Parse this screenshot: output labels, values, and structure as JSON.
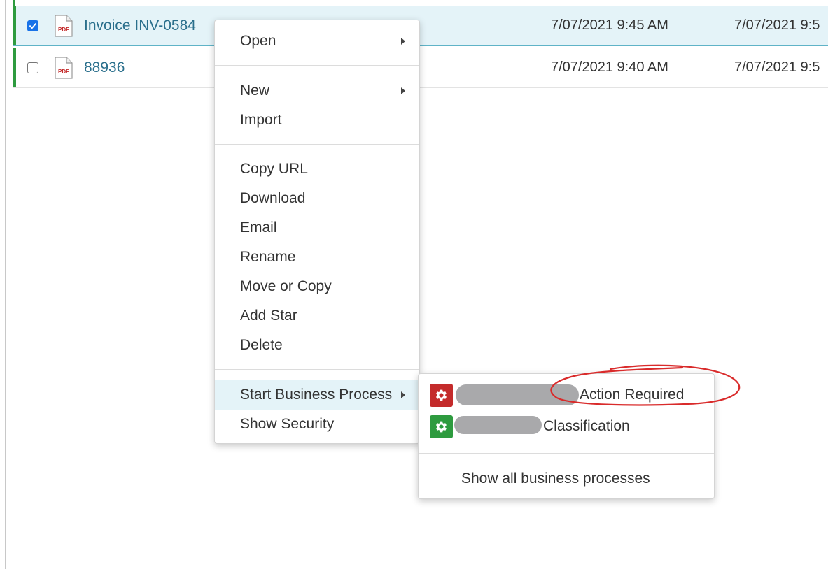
{
  "files": [
    {
      "name": "Invoice INV-0584",
      "date_modified": "7/07/2021 9:45 AM",
      "date_created": "7/07/2021 9:5",
      "checked": true,
      "icon": "pdf-icon",
      "icon_text": "PDF"
    },
    {
      "name": "88936",
      "date_modified": "7/07/2021 9:40 AM",
      "date_created": "7/07/2021 9:5",
      "checked": false,
      "icon": "pdf-icon",
      "icon_text": "PDF"
    }
  ],
  "context_menu": {
    "open": "Open",
    "new": "New",
    "import": "Import",
    "copy_url": "Copy URL",
    "download": "Download",
    "email": "Email",
    "rename": "Rename",
    "move_or_copy": "Move or Copy",
    "add_star": "Add Star",
    "delete": "Delete",
    "start_business_process": "Start Business Process",
    "show_security": "Show Security"
  },
  "business_process_submenu": {
    "items": [
      {
        "label": "Action Required",
        "icon": "gear-icon",
        "icon_color": "#c42b2b"
      },
      {
        "label": "Classification",
        "icon": "gear-icon",
        "icon_color": "#2e9b3f"
      }
    ],
    "show_all": "Show all business processes"
  },
  "colors": {
    "accent_green": "#2e9b3f",
    "selected_row": "#e4f3f8",
    "link_blue": "#2a6f8c",
    "annotation_red": "#d92b2b"
  }
}
